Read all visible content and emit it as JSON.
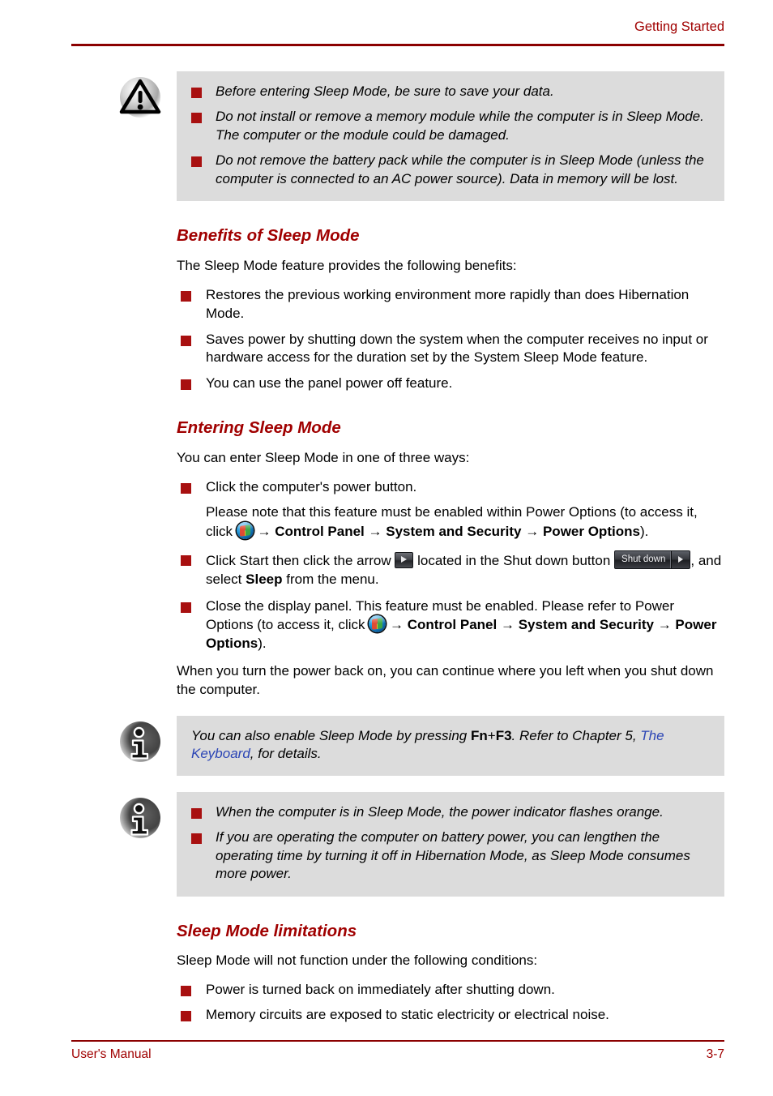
{
  "header": {
    "title": "Getting Started"
  },
  "footer": {
    "left": "User's Manual",
    "right": "3-7"
  },
  "colors": {
    "accent_red": "#A00000",
    "bullet_red": "#A81010",
    "panel_gray": "#DCDCDC",
    "link_blue": "#2B45B5"
  },
  "warning_box": {
    "icon": "warning-triangle-icon",
    "items": [
      "Before entering Sleep Mode, be sure to save your data.",
      "Do not install or remove a memory module while the computer is in Sleep Mode. The computer or the module could be damaged.",
      "Do not remove the battery pack while the computer is in Sleep Mode (unless the computer is connected to an AC power source). Data in memory will be lost."
    ]
  },
  "benefits": {
    "heading": "Benefits of Sleep Mode",
    "intro": "The Sleep Mode feature provides the following benefits:",
    "items": [
      "Restores the previous working environment more rapidly than does Hibernation Mode.",
      "Saves power by shutting down the system when the computer receives no input or hardware access for the duration set by the System Sleep Mode feature.",
      "You can use the panel power off feature."
    ]
  },
  "entering": {
    "heading": "Entering Sleep Mode",
    "intro": "You can enter Sleep Mode in one of three ways:",
    "item1": "Click the computer's power button.",
    "item1_note_a": "Please note that this feature must be enabled within Power Options (to access it, click",
    "item1_note_arrow1": "→",
    "item1_note_b": "Control Panel",
    "item1_note_arrow2": "→",
    "item1_note_c": "System and Security",
    "item1_note_arrow3": "→",
    "item1_note_d": "Power Options",
    "item1_note_e": ").",
    "item2_a": "Click Start then click the arrow",
    "item2_b": "located in the Shut down button",
    "item2_shutdown_label": "Shut down",
    "item2_c": ", and select",
    "item2_d": "Sleep",
    "item2_e": "from the menu.",
    "item3_a": "Close the display panel. This feature must be enabled. Please refer to Power Options (to access it, click",
    "item3_arrow1": "→",
    "item3_b": "Control Panel",
    "item3_arrow2": "→",
    "item3_c": "System and Security",
    "item3_arrow3": "→",
    "item3_d": "Power Options",
    "item3_e": ").",
    "closing": "When you turn the power back on, you can continue where you left when you shut down the computer."
  },
  "info_box_1": {
    "icon": "info-i-icon",
    "text_a": "You can also enable Sleep Mode by pressing",
    "key_fn": "Fn",
    "plus": "+",
    "key_f3": "F3",
    "text_b": ". Refer to Chapter 5,",
    "link": "The Keyboard",
    "text_c": ", for details."
  },
  "info_box_2": {
    "icon": "info-i-icon",
    "items": [
      "When the computer is in Sleep Mode, the power indicator flashes orange.",
      "If you are operating the computer on battery power, you can lengthen the operating time by turning it off in Hibernation Mode, as Sleep Mode consumes more power."
    ]
  },
  "limitations": {
    "heading": "Sleep Mode limitations",
    "intro": "Sleep Mode will not function under the following conditions:",
    "items": [
      "Power is turned back on immediately after shutting down.",
      "Memory circuits are exposed to static electricity or electrical noise."
    ]
  }
}
